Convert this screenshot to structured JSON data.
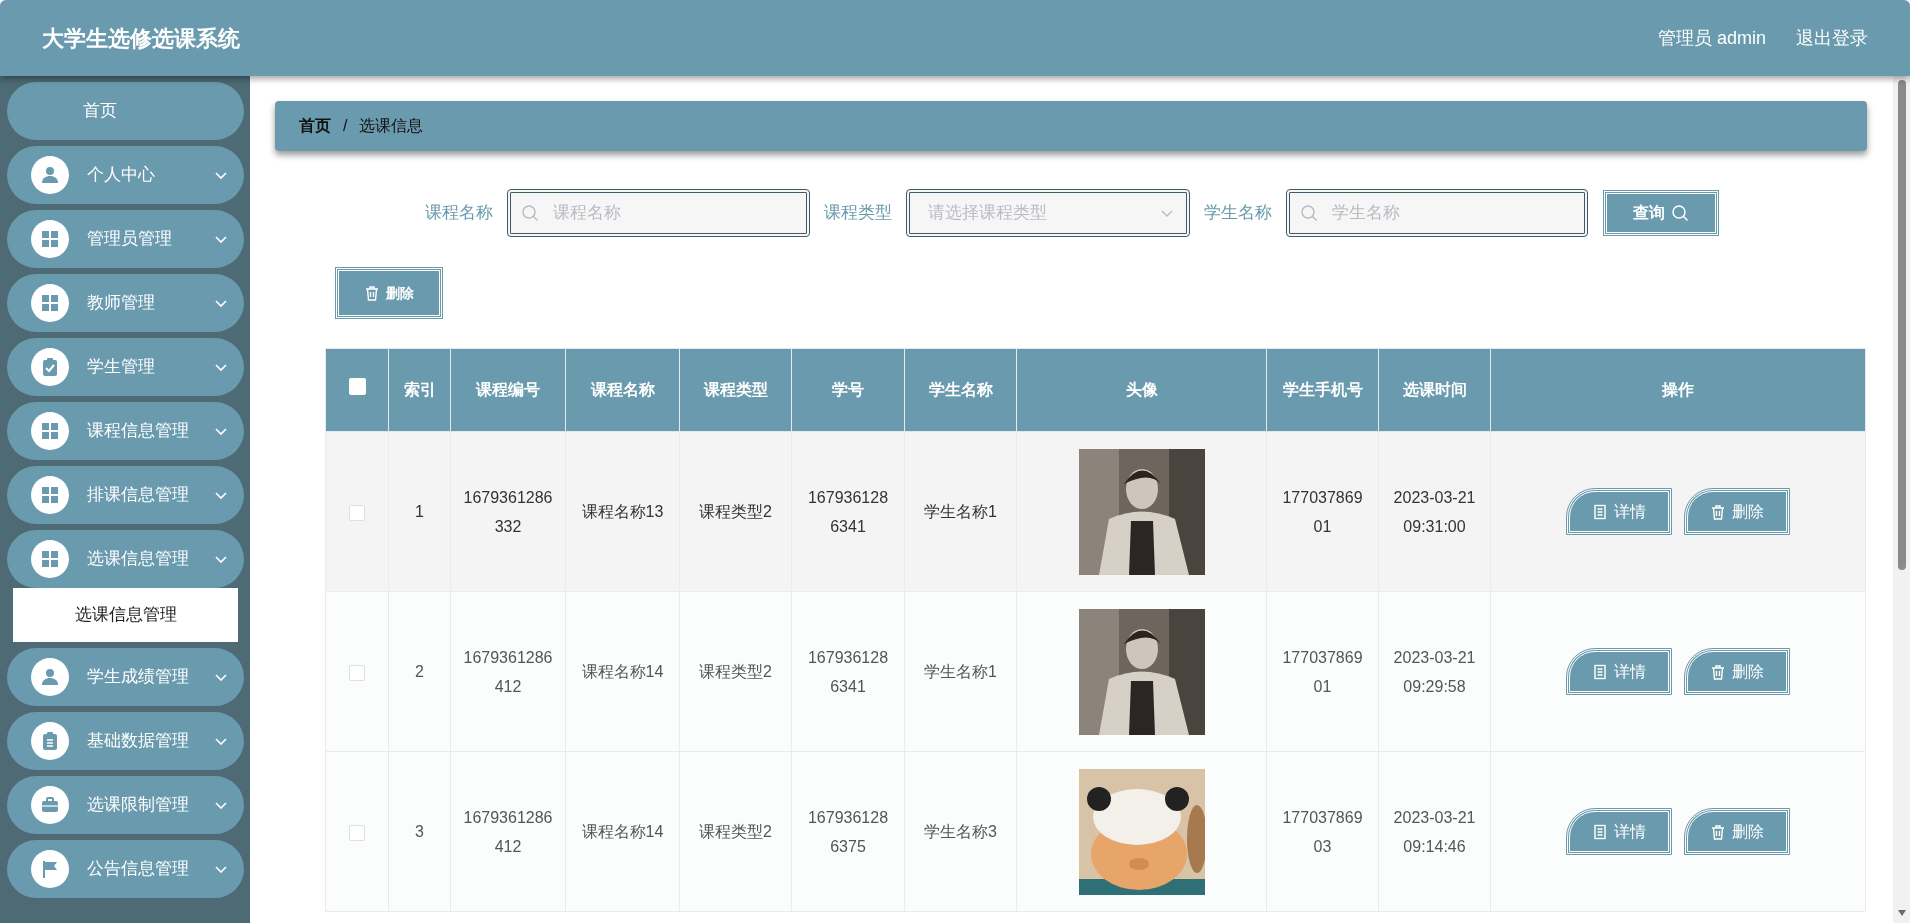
{
  "header": {
    "title": "大学生选修选课系统",
    "user": "管理员 admin",
    "logout": "退出登录"
  },
  "sidebar": {
    "items": [
      {
        "label": "首页",
        "kind": "link"
      },
      {
        "label": "个人中心",
        "kind": "menu"
      },
      {
        "label": "管理员管理",
        "kind": "menu"
      },
      {
        "label": "教师管理",
        "kind": "menu"
      },
      {
        "label": "学生管理",
        "kind": "menu"
      },
      {
        "label": "课程信息管理",
        "kind": "menu"
      },
      {
        "label": "排课信息管理",
        "kind": "menu"
      },
      {
        "label": "选课信息管理",
        "kind": "menu",
        "children": [
          {
            "label": "选课信息管理",
            "selected": true
          }
        ]
      },
      {
        "label": "学生成绩管理",
        "kind": "menu"
      },
      {
        "label": "基础数据管理",
        "kind": "menu"
      },
      {
        "label": "选课限制管理",
        "kind": "menu"
      },
      {
        "label": "公告信息管理",
        "kind": "menu"
      }
    ]
  },
  "breadcrumb": {
    "items": [
      "首页",
      "选课信息"
    ],
    "separator": "/"
  },
  "search": {
    "fields": [
      {
        "label": "课程名称",
        "kind": "text",
        "placeholder": "课程名称"
      },
      {
        "label": "课程类型",
        "kind": "select",
        "placeholder": "请选择课程类型"
      },
      {
        "label": "学生名称",
        "kind": "text",
        "placeholder": "学生名称"
      }
    ],
    "button": "查询"
  },
  "toolbar": {
    "delete_button": "删除"
  },
  "table": {
    "header_checkbox": {
      "checked": false
    },
    "columns": [
      "索引",
      "课程编号",
      "课程名称",
      "课程类型",
      "学号",
      "学生名称",
      "头像",
      "学生手机号",
      "选课时间",
      "操作"
    ],
    "rows": [
      {
        "checked": false,
        "hovered": true,
        "index": "1",
        "course_no": "1679361286332",
        "course_name": "课程名称13",
        "course_type": "课程类型2",
        "student_no": "1679361286341",
        "student_name": "学生名称1",
        "avatar": {
          "kind": "picture"
        },
        "phone": "17703786901",
        "time": "2023-03-21 09:31:00",
        "actions": [
          "详情",
          "删除"
        ]
      },
      {
        "checked": false,
        "hovered": false,
        "index": "2",
        "course_no": "1679361286412",
        "course_name": "课程名称14",
        "course_type": "课程类型2",
        "student_no": "1679361286341",
        "student_name": "学生名称1",
        "avatar": {
          "kind": "picture"
        },
        "phone": "17703786901",
        "time": "2023-03-21 09:29:58",
        "actions": [
          "详情",
          "删除"
        ]
      },
      {
        "checked": false,
        "hovered": false,
        "index": "3",
        "course_no": "1679361286412",
        "course_name": "课程名称14",
        "course_type": "课程类型2",
        "student_no": "1679361286375",
        "student_name": "学生名称3",
        "avatar": {
          "kind": "picture"
        },
        "phone": "17703786903",
        "time": "2023-03-21 09:14:46",
        "actions": [
          "详情",
          "删除"
        ]
      }
    ]
  }
}
